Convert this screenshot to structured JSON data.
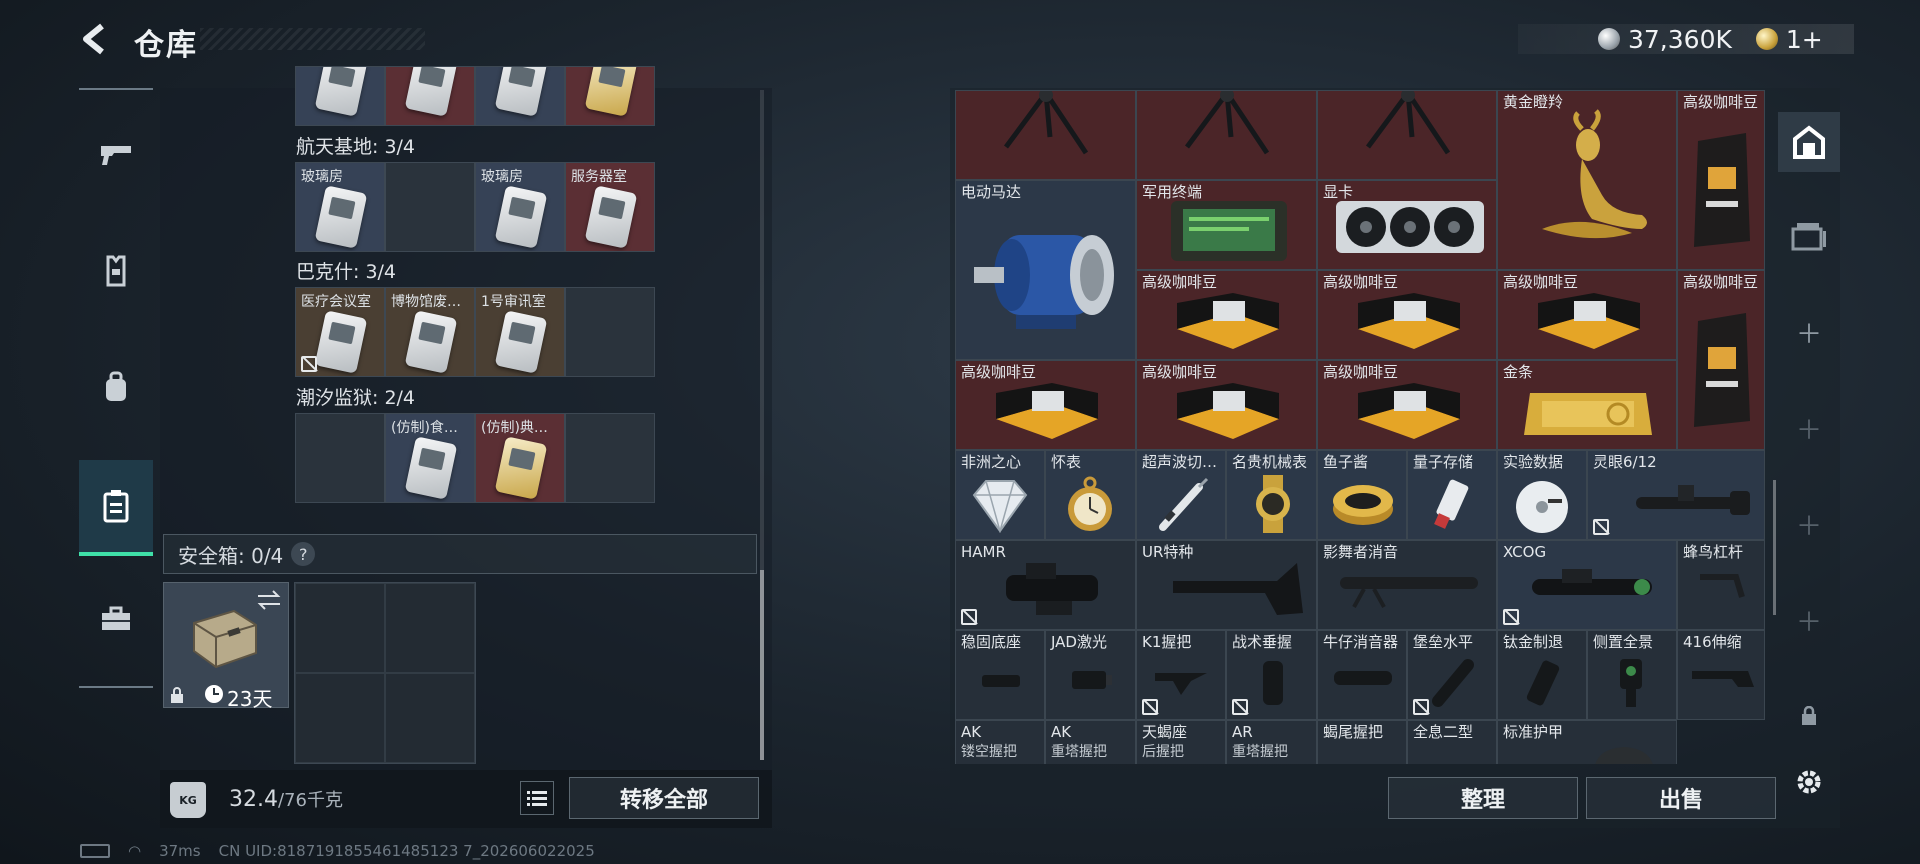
{
  "header": {
    "title": "仓库",
    "currency_amount": "37,360K",
    "premium_amount": "1+"
  },
  "left_nav": {
    "items": [
      "weapons",
      "armor",
      "backpack",
      "keycard-holder",
      "toolbox"
    ]
  },
  "keycards": {
    "top_partial": [
      {
        "color": "blue"
      },
      {
        "color": "red"
      },
      {
        "color": "blue"
      },
      {
        "color": "red"
      }
    ],
    "groups": [
      {
        "title": "航天基地: 3/4",
        "cells": [
          {
            "label": "玻璃房",
            "color": "blue",
            "card": "white"
          },
          {
            "label": "",
            "color": "empty",
            "card": ""
          },
          {
            "label": "玻璃房",
            "color": "blue",
            "card": "white"
          },
          {
            "label": "服务器室",
            "color": "red",
            "card": "white"
          }
        ]
      },
      {
        "title": "巴克什: 3/4",
        "cells": [
          {
            "label": "医疗会议室",
            "color": "tan",
            "card": "white",
            "no_trade": true
          },
          {
            "label": "博物馆废…",
            "color": "tan",
            "card": "white"
          },
          {
            "label": "1号审讯室",
            "color": "tan",
            "card": "white"
          },
          {
            "label": "",
            "color": "empty",
            "card": ""
          }
        ]
      },
      {
        "title": "潮汐监狱: 2/4",
        "cells": [
          {
            "label": "",
            "color": "empty",
            "card": ""
          },
          {
            "label": "(仿制)食…",
            "color": "blue",
            "card": "white"
          },
          {
            "label": "(仿制)典…",
            "color": "red",
            "card": "gold"
          },
          {
            "label": "",
            "color": "empty",
            "card": ""
          }
        ]
      }
    ]
  },
  "safe_box": {
    "title": "安全箱: 0/4",
    "help": "?",
    "duration": "23天"
  },
  "capacity": {
    "current": "32.4",
    "max": "/76千克",
    "unit_icon": "KG"
  },
  "buttons": {
    "transfer_all": "转移全部",
    "organize": "整理",
    "sell": "出售"
  },
  "items": {
    "row0": [
      "",
      "",
      "",
      "黄金瞪羚",
      "高级咖啡豆"
    ],
    "electric_motor": "电动马达",
    "military_terminal": "军用终端",
    "gpu": "显卡",
    "coffee": "高级咖啡豆",
    "gold_bar": "金条",
    "row_small": [
      "非洲之心",
      "怀表",
      "超声波切…",
      "名贵机械表",
      "鱼子酱",
      "量子存储",
      "实验数据",
      "灵眼6/12"
    ],
    "row_att1": [
      "HAMR",
      "UR特种",
      "影舞者消音",
      "XCOG",
      "蜂鸟杠杆"
    ],
    "row_att2": [
      "稳固底座",
      "JAD激光",
      "K1握把",
      "战术垂握",
      "牛仔消音器",
      "堡垒水平",
      "钛金制退",
      "侧置全景",
      "416伸缩"
    ],
    "row_att3": [
      {
        "l1": "AK",
        "l2": "镂空握把"
      },
      {
        "l1": "AK",
        "l2": "重塔握把"
      },
      {
        "l1": "天蝎座",
        "l2": "后握把"
      },
      {
        "l1": "AR",
        "l2": "重塔握把"
      },
      {
        "l1": "蝎尾握把",
        "l2": ""
      },
      {
        "l1": "全息二型",
        "l2": ""
      },
      {
        "l1": "标准护甲",
        "l2": ""
      }
    ]
  },
  "status_bar": {
    "ping": "37ms",
    "uid": "CN UID:8187191855461485123 7_202606022025"
  },
  "colors": {
    "accent": "#3fe0a8",
    "red_cell": "#4b2528",
    "blue_cell": "#2c3848"
  }
}
